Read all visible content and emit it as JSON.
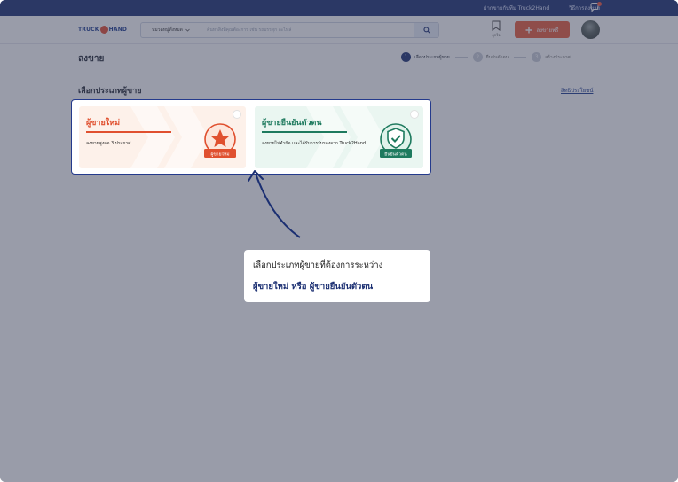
{
  "topbar": {
    "link_1": "ฝากขายกับทีม Truck2Hand",
    "link_2": "วิธีการลงขาย",
    "colors": {
      "background": "#1b2f72",
      "badge": "#f0553c"
    }
  },
  "header": {
    "logo_left": "TRUCK",
    "logo_right": "HAND",
    "search": {
      "category_label": "หมวดหมู่ทั้งหมด",
      "placeholder": "ค้นหาสิ่งที่คุณต้องการ เช่น รถบรรทุก อะไหล่",
      "search_icon": "search-icon"
    },
    "favorite_label": "ถูกใจ",
    "sell_button_label": "ลงขายฟรี"
  },
  "page": {
    "title": "ลงขาย",
    "steps": [
      {
        "number": "1",
        "label": "เลือกประเภทผู้ขาย",
        "active": true
      },
      {
        "number": "2",
        "label": "ยืนยันตัวตน",
        "active": false
      },
      {
        "number": "3",
        "label": "สร้างประกาศ",
        "active": false
      }
    ]
  },
  "section": {
    "title": "เลือกประเภทผู้ขาย",
    "link": "สิทธิประโยชน์"
  },
  "cards": {
    "new_seller": {
      "title": "ผู้ขายใหม่",
      "description": "ลงขายสูงสุด 3 ประกาศ",
      "badge_label": "ผู้ขายใหม่",
      "badge_icon": "star-badge-icon",
      "color": "#e0502f"
    },
    "verified_seller": {
      "title": "ผู้ขายยืนยันตัวตน",
      "description": "ลงขายไม่จำกัด และได้รับการรับรองจาก Truck2Hand",
      "badge_label": "ยืนยันตัวตน",
      "badge_icon": "shield-check-badge-icon",
      "color": "#1e7a5e"
    }
  },
  "coachmark": {
    "line_1": "เลือกประเภทผู้ขายที่ต้องการระหว่าง",
    "line_2": "ผู้ขายใหม่ หรือ ผู้ขายยืนยันตัวตน"
  }
}
